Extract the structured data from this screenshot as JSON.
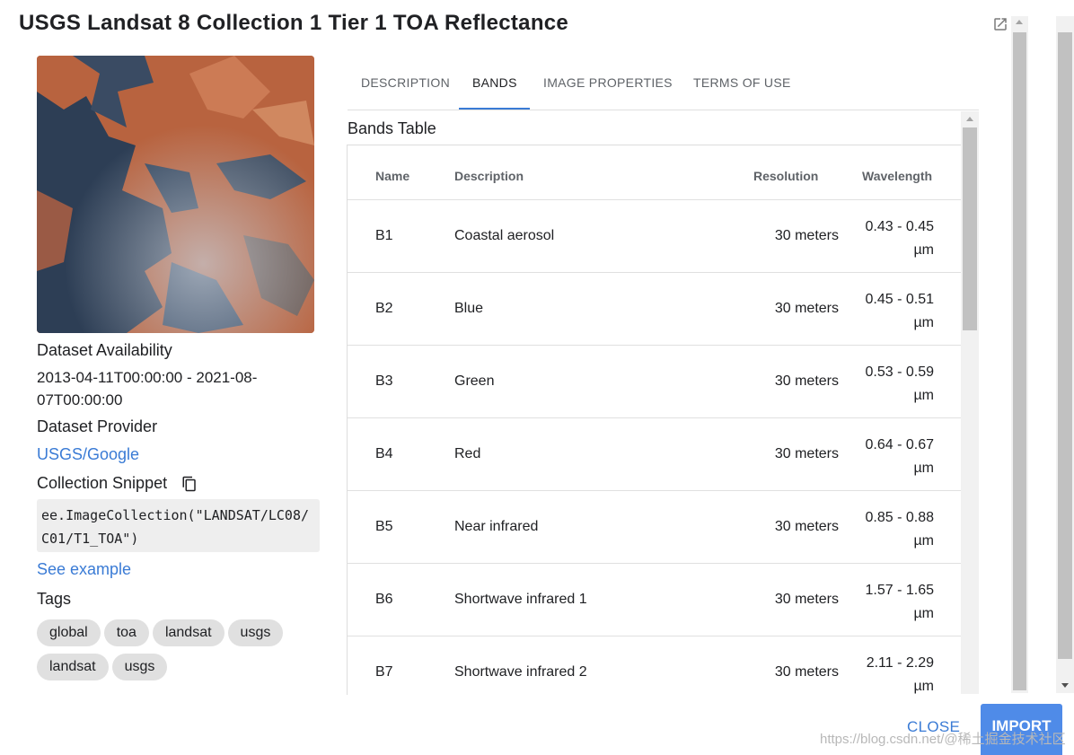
{
  "dialog": {
    "title": "USGS Landsat 8 Collection 1 Tier 1 TOA Reflectance"
  },
  "sidebar": {
    "availability_label": "Dataset Availability",
    "availability_line1": "2013-04-11T00:00:00 - 2021-08-",
    "availability_line2": "07T00:00:00",
    "provider_label": "Dataset Provider",
    "provider_link": "USGS/Google",
    "snippet_label": "Collection Snippet",
    "snippet_code": "ee.ImageCollection(\"LANDSAT/LC08/\nC01/T1_TOA\")",
    "example_link": "See example",
    "tags_label": "Tags",
    "tags": [
      "global",
      "toa",
      "landsat",
      "usgs",
      "landsat",
      "usgs"
    ]
  },
  "tabs": [
    "DESCRIPTION",
    "BANDS",
    "IMAGE PROPERTIES",
    "TERMS OF USE"
  ],
  "active_tab": "BANDS",
  "bands": {
    "title": "Bands Table",
    "columns": [
      "Name",
      "Description",
      "Resolution",
      "Wavelength"
    ],
    "rows": [
      {
        "name": "B1",
        "description": "Coastal aerosol",
        "resolution": "30 meters",
        "wl1": "0.43 - 0.45",
        "wl2": "µm"
      },
      {
        "name": "B2",
        "description": "Blue",
        "resolution": "30 meters",
        "wl1": "0.45 - 0.51",
        "wl2": "µm"
      },
      {
        "name": "B3",
        "description": "Green",
        "resolution": "30 meters",
        "wl1": "0.53 - 0.59",
        "wl2": "µm"
      },
      {
        "name": "B4",
        "description": "Red",
        "resolution": "30 meters",
        "wl1": "0.64 - 0.67",
        "wl2": "µm"
      },
      {
        "name": "B5",
        "description": "Near infrared",
        "resolution": "30 meters",
        "wl1": "0.85 - 0.88",
        "wl2": "µm"
      },
      {
        "name": "B6",
        "description": "Shortwave infrared 1",
        "resolution": "30 meters",
        "wl1": "1.57 - 1.65",
        "wl2": "µm"
      },
      {
        "name": "B7",
        "description": "Shortwave infrared 2",
        "resolution": "30 meters",
        "wl1": "2.11 - 2.29",
        "wl2": "µm"
      }
    ]
  },
  "actions": {
    "close_label": "CLOSE",
    "import_label": "IMPORT"
  },
  "watermark": "https://blog.csdn.net/@稀土掘金技术社区",
  "colors": {
    "accent": "#3a7bd5",
    "import_bg": "#4f8be8",
    "tag_bg": "#e0e0e0",
    "snippet_bg": "#eeeeee"
  }
}
